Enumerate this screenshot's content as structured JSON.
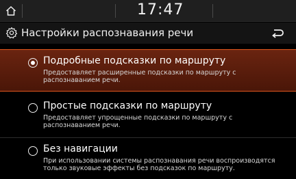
{
  "status": {
    "time": "17:47",
    "home_icon": "home-icon"
  },
  "header": {
    "title": "Настройки распознавания речи",
    "settings_icon": "gear-icon",
    "back_icon": "back-arrow-icon"
  },
  "options": [
    {
      "title": "Подробные подсказки по маршруту",
      "description": "Предоставляет расширенные подсказки по маршруту с распознаванием речи.",
      "selected": true
    },
    {
      "title": "Простые подсказки по маршруту",
      "description": "Предоставляет упрощенные подсказки по маршруту с распознаванием речи.",
      "selected": false
    },
    {
      "title": "Без навигации",
      "description": "При использовании системы распознавания речи воспроизводятся только звуковые эффекты без подсказок по маршруту.",
      "selected": false
    }
  ],
  "colors": {
    "accent": "#e2571e",
    "selected_bg": "#5c1e0c"
  }
}
